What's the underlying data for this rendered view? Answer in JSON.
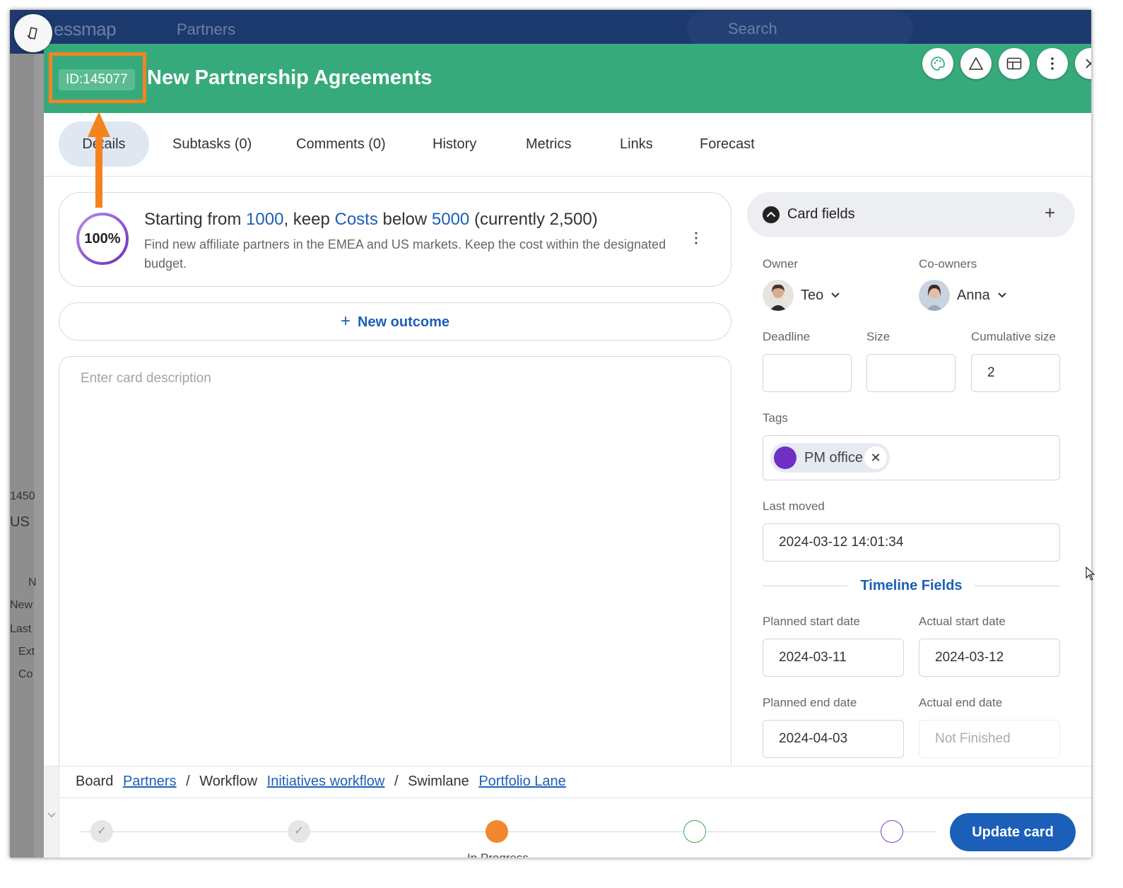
{
  "background": {
    "brand": "essmap",
    "nav_item": "Partners",
    "search_placeholder": "Search",
    "left_fragments": [
      "1450",
      "US",
      "N",
      "New",
      "Last",
      "Ext",
      "Co"
    ]
  },
  "header": {
    "id_badge": "ID:145077",
    "title": "New Partnership Agreements",
    "color": "#37aa7c",
    "actions": [
      "palette-icon",
      "warning-icon",
      "layout-icon",
      "more-vertical-icon",
      "close-icon"
    ]
  },
  "tabs": [
    {
      "label": "Details",
      "active": true
    },
    {
      "label": "Subtasks (0)"
    },
    {
      "label": "Comments (0)"
    },
    {
      "label": "History"
    },
    {
      "label": "Metrics"
    },
    {
      "label": "Links"
    },
    {
      "label": "Forecast"
    }
  ],
  "outcome": {
    "progress_label": "100%",
    "progress": 1.0,
    "title_parts": {
      "p1": "Starting from ",
      "v1": "1000",
      "p2": ", keep ",
      "v2": "Costs",
      "p3": " below ",
      "v3": "5000",
      "p4": " (currently ",
      "v4": "2,500",
      "p5": ")"
    },
    "description": "Find new affiliate partners in the EMEA and US markets. Keep the cost within the designated budget."
  },
  "new_outcome_label": "New outcome",
  "description_placeholder": "Enter card description",
  "card_fields": {
    "title": "Card fields",
    "owner_label": "Owner",
    "owner": "Teo",
    "coowners_label": "Co-owners",
    "coowner": "Anna",
    "deadline_label": "Deadline",
    "deadline_value": "",
    "size_label": "Size",
    "size_value": "",
    "cumulative_label": "Cumulative size",
    "cumulative_value": "2",
    "tags_label": "Tags",
    "tag": "PM office",
    "tag_color": "#6f2fc4",
    "last_moved_label": "Last moved",
    "last_moved_value": "2024-03-12 14:01:34",
    "timeline_title": "Timeline Fields",
    "planned_start_label": "Planned start date",
    "planned_start_value": "2024-03-11",
    "actual_start_label": "Actual start date",
    "actual_start_value": "2024-03-12",
    "planned_end_label": "Planned end date",
    "planned_end_value": "2024-04-03",
    "actual_end_label": "Actual end date",
    "actual_end_placeholder": "Not Finished"
  },
  "breadcrumb": {
    "board_label": "Board",
    "board": "Partners",
    "sep1": "/",
    "workflow_label": "Workflow",
    "workflow": "Initiatives workflow",
    "sep2": "/",
    "swimlane_label": "Swimlane",
    "swimlane": "Portfolio Lane"
  },
  "stepper": {
    "current_label": "In Progress",
    "active_color": "#f2872f"
  },
  "update_button": "Update card"
}
